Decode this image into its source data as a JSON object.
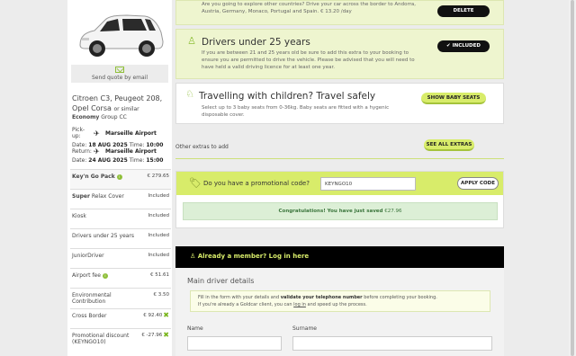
{
  "sidebar": {
    "send_quote": "Send quote by email",
    "car_name": "Citroen C3, Peugeot 208, Opel Corsa",
    "car_similar": "or similar",
    "car_class_bold": "Economy",
    "car_class_rest": "Group CC",
    "pickup": {
      "label": "Pick-up:",
      "location": "Marseille Airport",
      "date_label": "Date:",
      "date": "18 AUG 2025",
      "time_label": "Time:",
      "time": "10:00"
    },
    "return": {
      "label": "Return:",
      "location": "Marseille Airport",
      "date_label": "Date:",
      "date": "24 AUG 2025",
      "time_label": "Time:",
      "time": "15:00"
    },
    "prices": [
      {
        "name_bold": "Key'n Go Pack",
        "name": "",
        "value": "€ 279.65",
        "info": true,
        "remove": false,
        "highlight": true
      },
      {
        "name_bold": "Super",
        "name": " Relax Cover",
        "value": "Included",
        "info": false,
        "remove": false,
        "highlight": false
      },
      {
        "name_bold": "",
        "name": "Kiosk",
        "value": "Included",
        "info": false,
        "remove": false,
        "highlight": false
      },
      {
        "name_bold": "",
        "name": "Drivers under 25 years",
        "value": "Included",
        "info": false,
        "remove": false,
        "highlight": false
      },
      {
        "name_bold": "",
        "name": "JuniorDriver",
        "value": "Included",
        "info": false,
        "remove": false,
        "highlight": false
      },
      {
        "name_bold": "",
        "name": "Airport fee",
        "value": "€ 51.61",
        "info": true,
        "remove": false,
        "highlight": false
      },
      {
        "name_bold": "",
        "name": "Environmental Contribution",
        "value": "€ 3.50",
        "info": false,
        "remove": false,
        "highlight": false
      },
      {
        "name_bold": "",
        "name": "Cross Border",
        "value": "€ 92.40",
        "info": false,
        "remove": true,
        "highlight": false
      },
      {
        "name_bold": "",
        "name": "Promotional discount (KEYNGO10)",
        "value": "€ -27.96",
        "info": false,
        "remove": true,
        "highlight": false
      }
    ]
  },
  "cross_border": {
    "text": "Are you going to explore other countries? Drive your car across the border to Andorra, Austria, Germany, Monaco, Portugal and Spain. € 13.20 /day",
    "button": "DELETE"
  },
  "under25": {
    "title": "Drivers under 25 years",
    "text": "If you are between 21 and 25 years old be sure to add this extra to your booking to ensure you are permitted to drive the vehicle. Please be advised that you will need to have held a valid driving licence for at least one year.",
    "button": "INCLUDED"
  },
  "children": {
    "title": "Travelling with children? Travel safely",
    "text": "Select up to 3 baby seats from 0-36kg. Baby seats are fitted with a hygenic disposable cover.",
    "button": "SHOW BABY SEATS"
  },
  "other_extras": {
    "label": "Other extras to add",
    "button": "SEE ALL EXTRAS"
  },
  "promo": {
    "label": "Do you have a promotional code?",
    "value": "KEYNGO10",
    "button": "APPLY CODE",
    "success_bold": "Congratulations! You have just saved",
    "success_amount": "€27.96"
  },
  "member": {
    "label": "Already a member? Log in here"
  },
  "driver": {
    "title": "Main driver details",
    "note_1": "Fill in the form with your details and ",
    "note_bold": "validate your telephone number",
    "note_2": " before completing your booking.",
    "note_3": "If you're already a Goldcar client, you can ",
    "note_link": "log in",
    "note_4": " and speed up the process.",
    "name_label": "Name",
    "surname_label": "Surname"
  },
  "colors": {
    "accent": "#d8ec6a",
    "success": "#dcefd6",
    "dark": "#000000"
  }
}
